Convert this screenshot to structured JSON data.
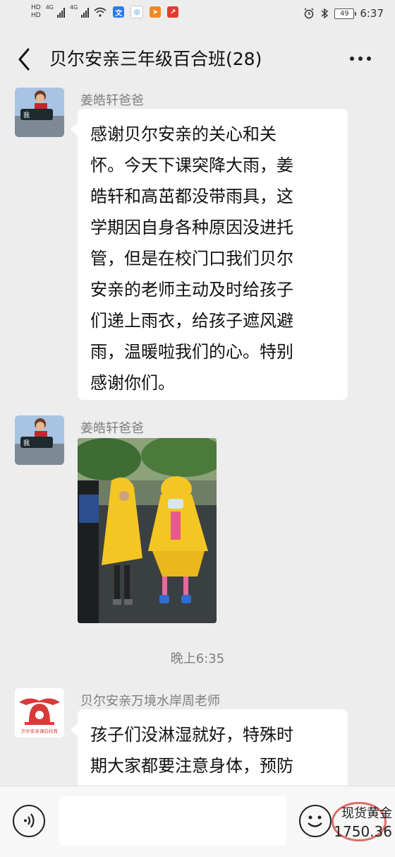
{
  "status_bar": {
    "hd1": "HD",
    "hd2": "HD",
    "net1": "4G",
    "net2": "4G",
    "battery": "49",
    "time": "6:37"
  },
  "header": {
    "title": "贝尔安亲三年级百合班(28)",
    "back_icon": "chevron-left-icon",
    "more_icon": "more-dots-icon"
  },
  "messages": [
    {
      "sender": "姜皓轩爸爸",
      "lines": [
        "感谢贝尔安亲的关心和关",
        "怀。今天下课突降大雨，姜",
        "皓轩和高茁都没带雨具，这",
        "学期因自身各种原因没进托",
        "管，但是在校门口我们贝尔",
        "安亲的老师主动及时给孩子",
        "们递上雨衣，给孩子遮风避",
        "雨，温暖啦我们的心。特别",
        "感谢你们。"
      ]
    },
    {
      "sender": "姜皓轩爸爸"
    },
    {
      "sender": "贝尔安亲万境水岸周老师",
      "avatar_text": "贝尔安亲课后托育",
      "lines": [
        "孩子们没淋湿就好，特殊时",
        "期大家都要注意身体，预防"
      ]
    }
  ],
  "timestamp": "晚上6:35",
  "input_bar": {
    "voice_icon": "voice-icon",
    "emoji_icon": "emoji-icon"
  },
  "ad": {
    "label": "现货黄金",
    "value": "1750.36"
  },
  "colors": {
    "background": "#ededed",
    "bubble": "#ffffff",
    "secondary_text": "#7f7f7f",
    "raincoat": "#f3c623",
    "logo_red": "#d83a3a"
  }
}
